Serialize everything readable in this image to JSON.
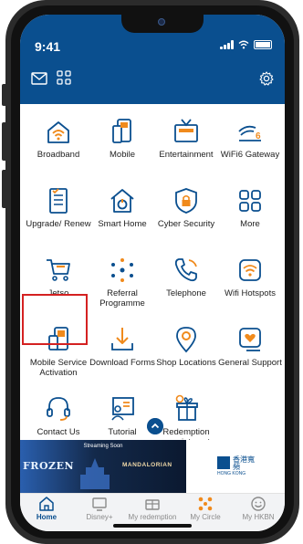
{
  "status": {
    "time": "9:41"
  },
  "header": {
    "mail_icon": "mail-icon",
    "qr_icon": "qr-scan-icon",
    "settings_icon": "gear-icon"
  },
  "grid": [
    {
      "label": "Broadband",
      "icon": "router-wifi-icon"
    },
    {
      "label": "Mobile",
      "icon": "mobile-phone-icon"
    },
    {
      "label": "Entertainment",
      "icon": "tv-icon"
    },
    {
      "label": "WiFi6 Gateway",
      "icon": "wifi6-icon"
    },
    {
      "label": "Upgrade/ Renew",
      "icon": "document-check-icon"
    },
    {
      "label": "Smart Home",
      "icon": "smart-home-icon"
    },
    {
      "label": "Cyber Security",
      "icon": "shield-lock-icon"
    },
    {
      "label": "More",
      "icon": "grid-more-icon"
    },
    {
      "label": "Jetso",
      "icon": "shopping-cart-icon"
    },
    {
      "label": "Referral Programme",
      "icon": "referral-network-icon"
    },
    {
      "label": "Telephone",
      "icon": "telephone-icon"
    },
    {
      "label": "Wifi Hotspots",
      "icon": "wifi-hotspot-icon"
    },
    {
      "label": "Mobile Service Activation",
      "icon": "sim-phone-icon"
    },
    {
      "label": "Download Forms",
      "icon": "download-icon"
    },
    {
      "label": "Shop Locations",
      "icon": "location-pin-icon"
    },
    {
      "label": "General Support",
      "icon": "support-heart-icon"
    },
    {
      "label": "Contact Us",
      "icon": "headset-icon"
    },
    {
      "label": "Tutorial",
      "icon": "tutorial-board-icon"
    },
    {
      "label": "Redemption appointment",
      "icon": "gift-icon"
    }
  ],
  "banner": {
    "left_title": "Streaming Soon",
    "frozen_text": "FROZEN",
    "mandalorian_text": "MANDALORIAN",
    "right_logo_cn": "香港寬頻",
    "right_logo_en": "HONG KONG"
  },
  "tabs": [
    {
      "label": "Home",
      "icon": "home-icon",
      "active": true
    },
    {
      "label": "Disney+",
      "icon": "tv-stream-icon",
      "active": false
    },
    {
      "label": "My redemption",
      "icon": "gift-card-icon",
      "active": false
    },
    {
      "label": "My Circle",
      "icon": "circle-network-icon",
      "active": false
    },
    {
      "label": "My HKBN",
      "icon": "smiley-icon",
      "active": false
    }
  ],
  "colors": {
    "brand_blue": "#0a4f8f",
    "accent_orange": "#f08a1c",
    "highlight_red": "#d42121"
  }
}
